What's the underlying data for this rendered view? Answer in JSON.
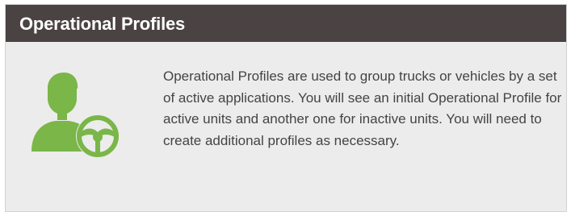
{
  "panel": {
    "title": "Operational Profiles",
    "icon": "driver-steering-wheel-icon",
    "description": "Operational Profiles are used to group trucks or vehicles by a set of active applications. You will see an initial Operational Profile for active units and another one for inactive units. You will need to create additional profiles as necessary."
  },
  "colors": {
    "header_bg": "#4a4243",
    "header_text": "#ffffff",
    "panel_bg": "#ececec",
    "icon_green": "#7ab648",
    "body_text": "#444444"
  }
}
